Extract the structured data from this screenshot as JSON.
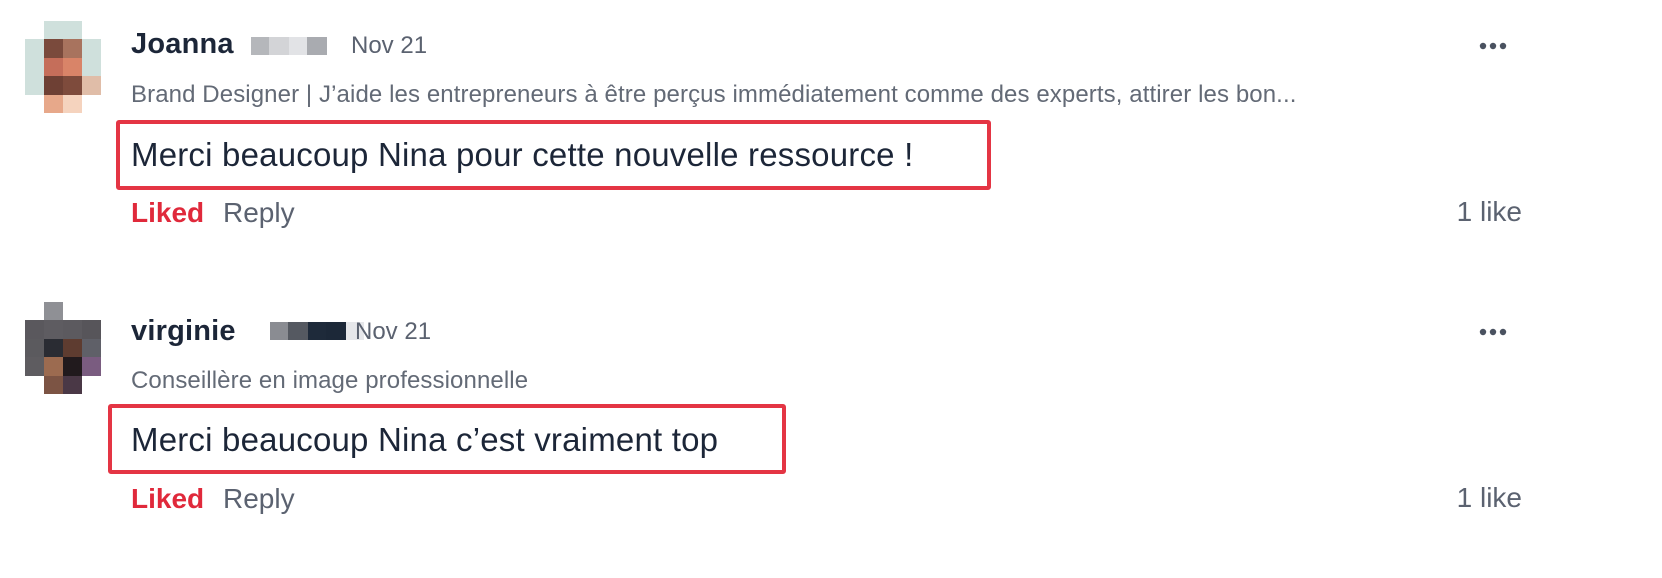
{
  "comments": [
    {
      "author": "Joanna",
      "date": "Nov 21",
      "headline": "Brand Designer | J’aide les entrepreneurs à être perçus immédiatement comme des experts, attirer les bon...",
      "body": "Merci beaucoup Nina pour cette nouvelle ressource !",
      "liked_label": "Liked",
      "reply_label": "Reply",
      "likes": "1 like",
      "more_icon": "more-horizontal-icon",
      "avatar": "pixelated-avatar",
      "highlight_color": "#e43544"
    },
    {
      "author": "virginie",
      "date": "Nov 21",
      "headline": "Conseillère en image professionnelle",
      "body": "Merci beaucoup Nina c’est vraiment top",
      "liked_label": "Liked",
      "reply_label": "Reply",
      "likes": "1 like",
      "more_icon": "more-horizontal-icon",
      "avatar": "pixelated-avatar",
      "highlight_color": "#e43544"
    }
  ],
  "colors": {
    "liked": "#e0293b",
    "name": "#1c2638",
    "muted": "#5b6270"
  }
}
